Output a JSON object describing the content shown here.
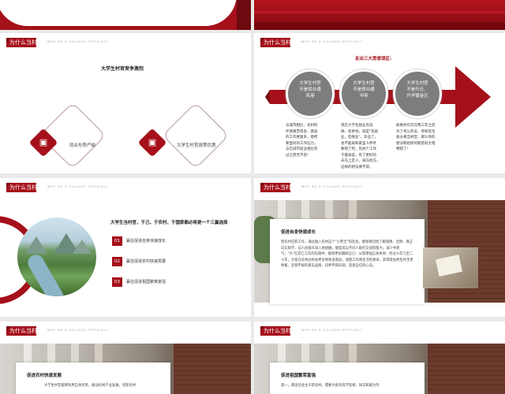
{
  "header": {
    "title_cn": "为什么当村官?",
    "title_en": "WHY BE A VILLAGE OFFICIAL?"
  },
  "slide2": {
    "title": "大学生村官竞争激烈",
    "items": [
      {
        "label": "就业形势严峻"
      },
      {
        "label": "大学生村官政策优惠"
      }
    ]
  },
  "slide3": {
    "title": "走出三大思想误区:",
    "circles": [
      {
        "text": "大学生村官\n不是就业避\n风港"
      },
      {
        "text": "大学生村官\n不是择业缓\n冲带"
      },
      {
        "text": "大学生村官\n不是升迁、\n升学镀金区"
      }
    ],
    "paragraphs": [
      "与城市相比，农村的\n环境艰苦得多，基层\n的工作要复杂，他所\n要面对的工作压力，\n与在城市就业相比有\n过之而无不及!",
      "现在大学生就业有选\n择、有余地，就是\"先就\n业，后择业\"，毕业了，\n总不能再和家里人伸手\n要钱了吧，先找个工作\n干着再说，有了更好的\n去马上走人，骑马找马，\n这样的想法要不得。",
      "如果你仅仅在两三年之后\n为了考公务员、考研究生\n加分来当村官，那么你的\n想法和组织的期望就大错\n特错了!"
    ]
  },
  "slide4": {
    "title": "大学生当村官，于己、于农村、于国家都必将是一个三赢选择",
    "items": [
      {
        "num": "01",
        "label": "赢在促进自身快速成长"
      },
      {
        "num": "02",
        "label": "赢在促进农村快速发展"
      },
      {
        "num": "03",
        "label": "赢在促进祖国繁荣富强"
      }
    ]
  },
  "slide5": {
    "card_title": "促进自身快速成长",
    "card_text": "到农村任职工作，通过融入农村这个\"小而全\"的社会，能够真切地了解国情、社情、真正向实际学、向人民群众深入地接触，能提高与不同人群打交道的能力，减少书卷气；\"大\"在其它工作的实践中，能够更好磨砺自己；从而增强自身本领；经过十年乃至二十年，大家在农村必将会更多地体会基层，清楚工作和生活的真谛，获得受益终生的宝贵财富，坚韧不拔的意志品质，培养平和乐观、宽容自信的心态。"
  },
  "slide6": {
    "card_title": "促进农村快速发展",
    "card_text": "大学生村官能够利用自身优势，推动农村产业发展，创新农村"
  },
  "slide7": {
    "card_title": "促进祖国繁荣富强",
    "card_text": "第一，建设社会主义新农村，需要大批有科学思想、知识和能力的"
  },
  "colors": {
    "accent": "#a5101a",
    "gray": "#7d7d7d",
    "dark_red": "#7a0a12"
  }
}
